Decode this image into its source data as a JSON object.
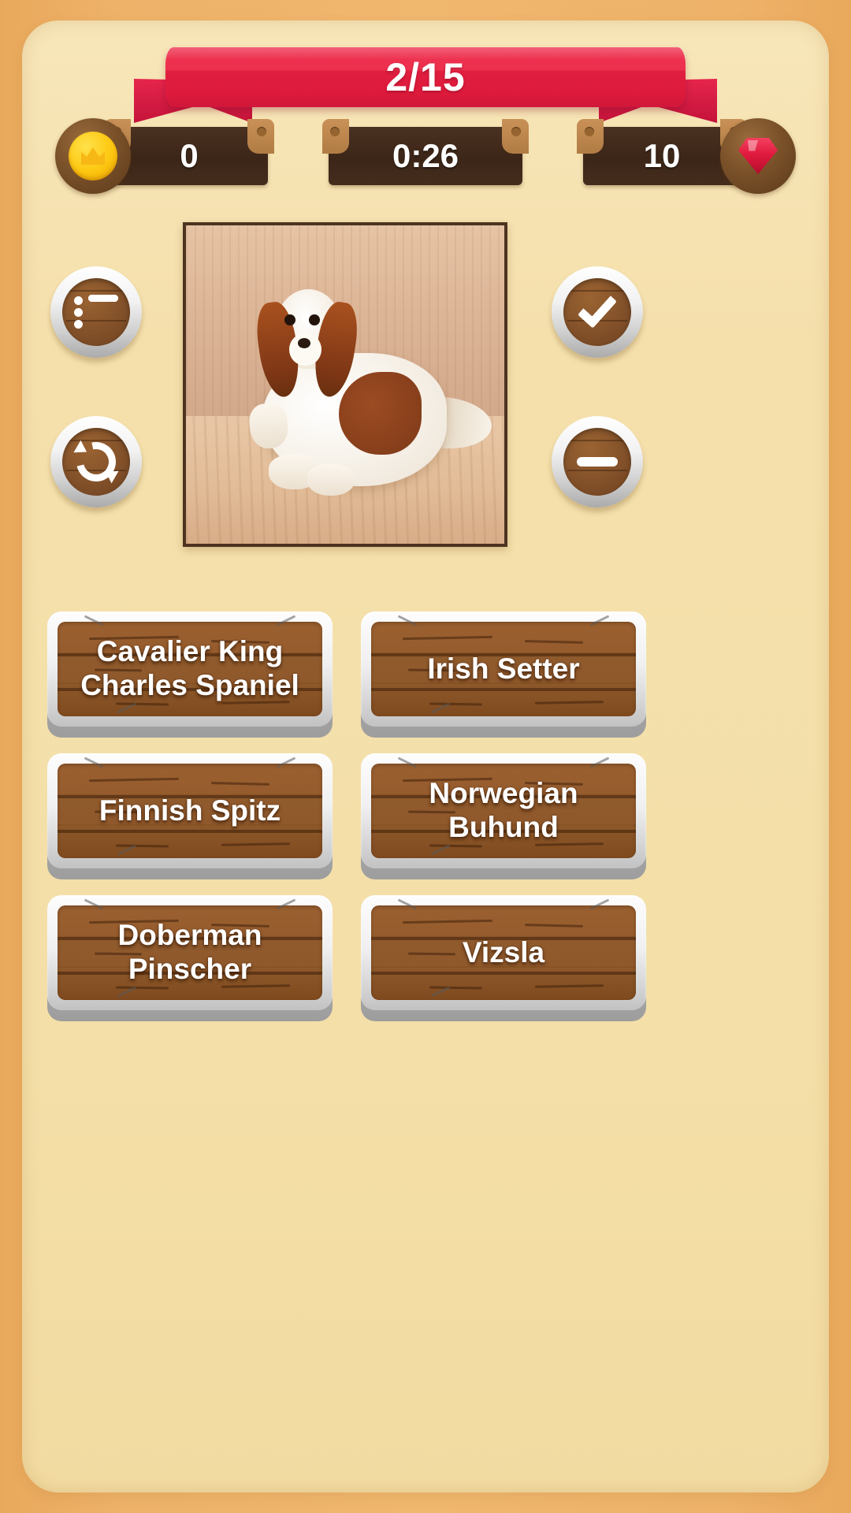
{
  "banner": {
    "progress": "2/15"
  },
  "stats": {
    "coins": {
      "value": "0",
      "icon": "coin-crown-icon"
    },
    "timer": {
      "value": "0:26",
      "icon": "timer-plate"
    },
    "gems": {
      "value": "10",
      "icon": "ruby-gem-icon"
    }
  },
  "side_buttons": {
    "list": {
      "name": "list-button",
      "icon": "list-icon"
    },
    "skip": {
      "name": "refresh-button",
      "icon": "refresh-icon"
    },
    "check": {
      "name": "check-button",
      "icon": "check-icon"
    },
    "remove": {
      "name": "remove-button",
      "icon": "minus-icon"
    }
  },
  "question": {
    "image_alt": "photo of a Cavalier King Charles Spaniel dog lying on a couch"
  },
  "answers": [
    {
      "label": "Cavalier King Charles Spaniel"
    },
    {
      "label": "Irish Setter"
    },
    {
      "label": "Finnish Spitz"
    },
    {
      "label": "Norwegian Buhund"
    },
    {
      "label": "Doberman Pinscher"
    },
    {
      "label": "Vizsla"
    }
  ],
  "colors": {
    "background_outer": "#eeb269",
    "panel": "#f5e0ac",
    "ribbon": "#e01e3f",
    "wood_button": "#90592c",
    "plate_dark": "#3c2617",
    "coin_gold": "#fdc913",
    "gem_red": "#e01b3e"
  }
}
